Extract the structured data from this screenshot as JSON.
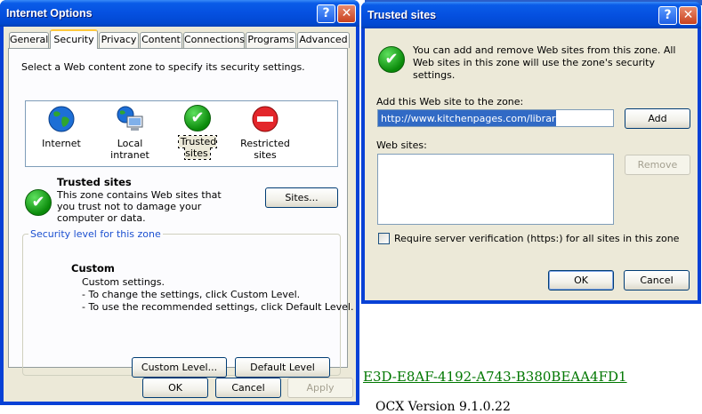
{
  "background_page": {
    "guid_link": "E3D-E8AF-4192-A743-B380BEAA4FD1",
    "ocx_text": "OCX Version 9.1.0.22"
  },
  "internet_options": {
    "title": "Internet Options",
    "tabs": [
      "General",
      "Security",
      "Privacy",
      "Content",
      "Connections",
      "Programs",
      "Advanced"
    ],
    "active_tab": "Security",
    "instruction": "Select a Web content zone to specify its security settings.",
    "zones": [
      {
        "label": "Internet",
        "icon": "globe-icon"
      },
      {
        "label": "Local intranet",
        "icon": "local-intranet-icon"
      },
      {
        "label": "Trusted sites",
        "icon": "trusted-sites-icon"
      },
      {
        "label": "Restricted sites",
        "icon": "restricted-sites-icon"
      }
    ],
    "zone_title": "Trusted sites",
    "zone_description": "This zone contains Web sites that you trust not to damage your computer or data.",
    "sites_button": "Sites...",
    "security_level_label": "Security level for this zone",
    "level_title": "Custom",
    "level_lines": [
      "Custom settings.",
      "- To change the settings, click Custom Level.",
      "- To use the recommended settings, click Default Level."
    ],
    "custom_level_button": "Custom Level...",
    "default_level_button": "Default Level",
    "ok_button": "OK",
    "cancel_button": "Cancel",
    "apply_button": "Apply"
  },
  "trusted_sites": {
    "title": "Trusted sites",
    "info": "You can add and remove Web sites from this zone. All Web sites in this zone will use the zone's security settings.",
    "add_label": "Add this Web site to the zone:",
    "add_value": "http://www.kitchenpages.com/library/net",
    "add_button": "Add",
    "websites_label": "Web sites:",
    "remove_button": "Remove",
    "require_verification": "Require server verification (https:) for all sites in this zone",
    "require_checked": false,
    "ok_button": "OK",
    "cancel_button": "Cancel"
  },
  "colors": {
    "titlebar": "#0550e0",
    "dialog_bg": "#ece9d8",
    "link_green": "#007700",
    "group_label": "#1c50d0"
  }
}
